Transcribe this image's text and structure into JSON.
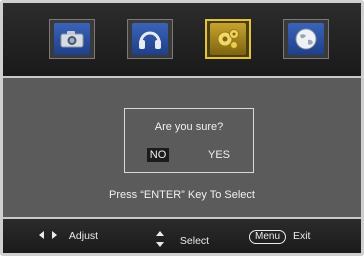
{
  "menu": {
    "tabs": [
      {
        "icon": "camera-icon",
        "active": false
      },
      {
        "icon": "headphones-icon",
        "active": false
      },
      {
        "icon": "gear-icon",
        "active": true
      },
      {
        "icon": "globe-icon",
        "active": false
      }
    ]
  },
  "dialog": {
    "question": "Are you sure?",
    "no_label": "NO",
    "yes_label": "YES",
    "selected": "NO"
  },
  "hint": "Press “ENTER” Key To Select",
  "footer": {
    "adjust_label": "Adjust",
    "select_label": "Select",
    "menu_key_label": "Menu",
    "exit_label": "Exit"
  },
  "colors": {
    "background": "#5b5b5b",
    "bar": "#1f1f1f",
    "accent_active": "#e6c23a",
    "icon_blue": "#2f56a8"
  }
}
